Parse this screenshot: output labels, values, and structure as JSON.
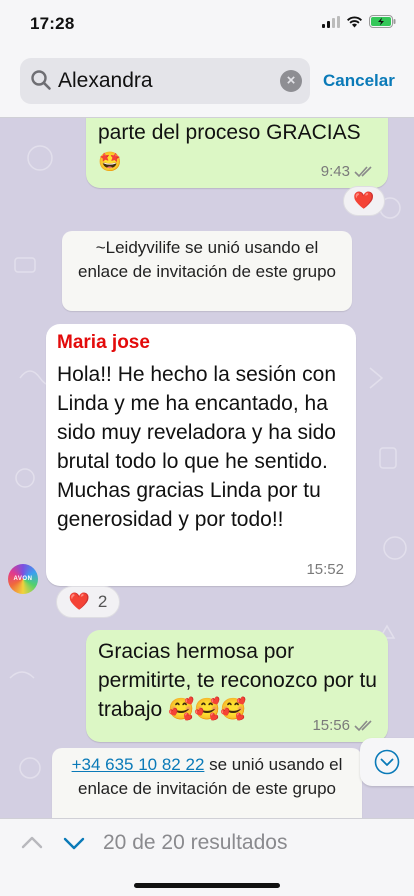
{
  "status_bar": {
    "time": "17:28"
  },
  "search": {
    "query": "Alexandra",
    "cancel_label": "Cancelar"
  },
  "messages": {
    "out1": {
      "text": "parte del proceso GRACIAS",
      "emoji": "🤩",
      "time": "9:43",
      "reaction": "❤️"
    },
    "system1": {
      "text": "~Leidyvilife se unió usando el enlace de invitación de este grupo"
    },
    "in1": {
      "sender": "Maria jose",
      "text": "Hola!! He hecho la sesión con Linda y me ha encantado, ha sido muy reveladora y ha sido brutal todo lo que he sentido. Muchas gracias Linda por tu generosidad y por todo!!",
      "time": "15:52",
      "reaction_emoji": "❤️",
      "reaction_count": "2",
      "avatar_label": "AVON"
    },
    "out2": {
      "text": "Gracias hermosa por permitirte, te reconozco por tu trabajo 🥰🥰🥰",
      "time": "15:56"
    },
    "system2": {
      "phone": "+34 635 10 82 22",
      "text": " se unió usando el enlace de invitación de este grupo"
    }
  },
  "results": {
    "label": "20 de 20 resultados"
  },
  "colors": {
    "accent": "#0a7ab8",
    "outgoing_bubble": "#dcf7c5",
    "sender_name": "#e30b0b",
    "chat_background": "#d3cfe2"
  }
}
